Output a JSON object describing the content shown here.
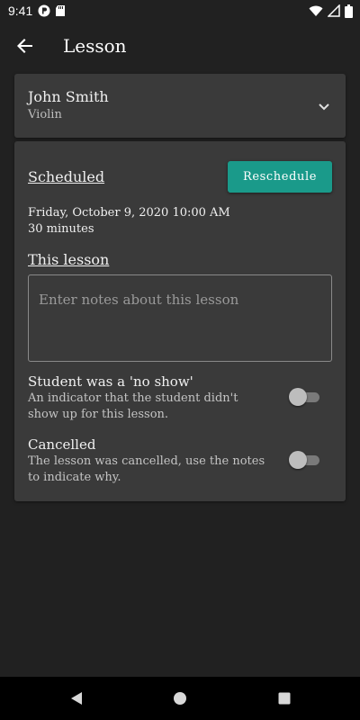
{
  "status_bar": {
    "time": "9:41"
  },
  "app_bar": {
    "title": "Lesson"
  },
  "student": {
    "name": "John Smith",
    "instrument": "Violin"
  },
  "lesson": {
    "scheduled_heading": "Scheduled",
    "reschedule_label": "Reschedule",
    "datetime": "Friday, October 9, 2020 10:00 AM",
    "duration": "30 minutes",
    "this_lesson_heading": "This lesson",
    "notes": {
      "value": "",
      "placeholder": "Enter notes about this lesson"
    },
    "no_show": {
      "title": "Student was a 'no show'",
      "description": "An indicator that the student didn't show up for this lesson.",
      "on": false
    },
    "cancelled": {
      "title": "Cancelled",
      "description": "The lesson was cancelled, use the notes to indicate why.",
      "on": false
    }
  },
  "colors": {
    "background": "#212121",
    "card": "#3a3a3a",
    "accent": "#1a9a8a"
  },
  "icons": {
    "back": "arrow-back-icon",
    "expand": "chevron-down-icon",
    "nav_back": "triangle-back-icon",
    "nav_home": "circle-home-icon",
    "nav_recents": "square-recents-icon"
  }
}
